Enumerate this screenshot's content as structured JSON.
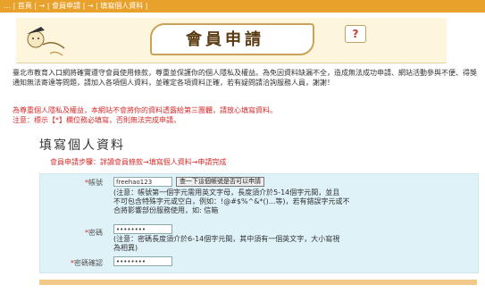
{
  "breadcrumb": "… | 首頁 | → | 會員申請 | → | 填寫個人資料 |",
  "banner": {
    "title": "會員申請",
    "help_label": "?"
  },
  "intro": "臺北市教育入口網將確實遵守會員使用條款，尊重並保護你的個人隱私及權益。為免因資料缺漏不全，造成無法成功申請、網站活動參與不便、得獎通知無法寄達等問題，請加入各項個人資料，並確定各項資料正確，若有疑問請洽詢服務人員，謝謝！",
  "note_line1": "為尊重個人隱私及權益，本網站不會將你的資料透露給第三團體，請放心填寫資料。",
  "note_line2": "注意：標示【*】欄位務必填寫，否則無法完成申請。",
  "section_title": "填寫個人資料",
  "steps": "會員申請步驟：詳讀會員條款→填寫個人資料→申請完成",
  "form": {
    "account": {
      "label": "帳號",
      "value": "freehao123",
      "check_button": "查一下這個帳號是否可以申請",
      "hint1": "(注意：帳號第一個字元需用英文字母，長度須介於5-14個字元間，並且",
      "hint2": "不可包含特殊字元或空白，例如：!@#$%^&*()...等)，若有錯誤字元或不",
      "hint3": "合將影響部份服務使用，如: 信箱"
    },
    "password": {
      "label": "密碼",
      "value": "••••••••",
      "hint1": "(注意：密碼長度須介於6-14個字元間，其中須有一個英文字，大小寫視",
      "hint2": "為相異)"
    },
    "password_confirm": {
      "label": "密碼確認",
      "value": "••••••••"
    }
  },
  "colors": {
    "breadcrumb_bg": "#e8a22c",
    "form_bg": "#dff2f8",
    "alert_red": "#d62b2b"
  }
}
